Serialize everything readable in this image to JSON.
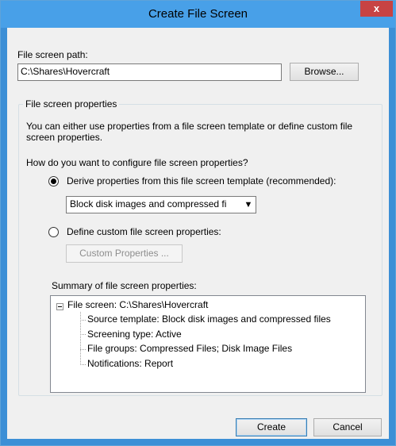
{
  "window": {
    "title": "Create File Screen",
    "close_label": "x"
  },
  "path": {
    "label": "File screen path:",
    "value": "C:\\Shares\\Hovercraft",
    "browse_label": "Browse..."
  },
  "properties": {
    "group_title": "File screen properties",
    "description": "You can either use properties from a file screen template or define custom file screen properties.",
    "question": "How do you want to configure file screen properties?",
    "derive_option_label": "Derive properties from this file screen template (recommended):",
    "template_selected": "Block disk images and compressed fi",
    "custom_option_label": "Define custom file screen properties:",
    "custom_button_label": "Custom Properties ..."
  },
  "summary": {
    "label": "Summary of file screen properties:",
    "root": "File screen: C:\\Shares\\Hovercraft",
    "items": [
      "Source template: Block disk images and compressed files",
      "Screening type: Active",
      "File groups: Compressed Files; Disk Image Files",
      "Notifications: Report"
    ]
  },
  "footer": {
    "create_label": "Create",
    "cancel_label": "Cancel"
  }
}
